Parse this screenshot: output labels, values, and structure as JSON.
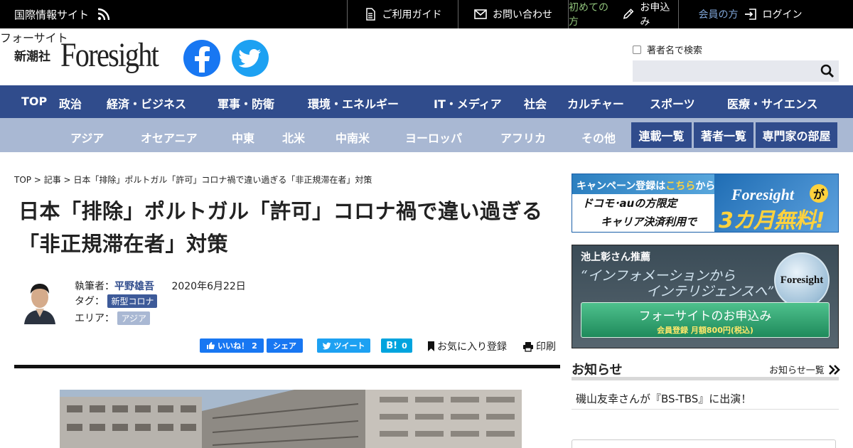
{
  "topbar": {
    "site_name": "国際情報サイト",
    "items": [
      {
        "icon": "document-icon",
        "label": "ご利用ガイド"
      },
      {
        "icon": "mail-icon",
        "label": "お問い合わせ"
      },
      {
        "prefix": "初めての方",
        "icon": "pen-icon",
        "label": "お申込み"
      },
      {
        "prefix": "会員の方",
        "icon": "login-icon",
        "label": "ログイン"
      }
    ]
  },
  "header": {
    "publisher": "新潮社",
    "logo": "Foresight",
    "logo_sub": "フォーサイト",
    "search_checkbox_label": "著者名で検索"
  },
  "main_nav": [
    "TOP",
    "政治",
    "経済・ビジネス",
    "軍事・防衛",
    "環境・エネルギー",
    "IT・メディア",
    "社会",
    "カルチャー",
    "スポーツ",
    "医療・サイエンス"
  ],
  "sub_nav": {
    "regions": [
      "アジア",
      "オセアニア",
      "中東",
      "北米",
      "中南米",
      "ヨーロッパ",
      "アフリカ",
      "その他"
    ],
    "pills": [
      "連載一覧",
      "著者一覧",
      "専門家の部屋"
    ]
  },
  "article": {
    "breadcrumb": "TOP > 記事 > 日本「排除」ポルトガル「許可」コロナ禍で違い過ぎる「非正規滞在者」対策",
    "title": "日本「排除」ポルトガル「許可」コロナ禍で違い過ぎる「非正規滞在者」対策",
    "author_label": "執筆者：",
    "author": "平野雄吾",
    "date": "2020年6月22日",
    "tag_label": "タグ：",
    "tag": "新型コロナ",
    "area_label": "エリア：",
    "area": "アジア"
  },
  "share": {
    "like_label": "いいね！",
    "like_count": "2",
    "share_label": "シェア",
    "tweet_label": "ツイート",
    "hatena_label": "B!",
    "hatena_count": "0",
    "favorite_label": "お気に入り登録",
    "print_label": "印刷"
  },
  "sidebar": {
    "campaign": {
      "head": "キャンペーン登録は",
      "head_hl": "こちら",
      "head_tail": "から",
      "line2": "ドコモ･auの方限定",
      "line3": "キャリア決済利用で",
      "logo": "Foresight",
      "ga": "が",
      "free": "3カ月無料!"
    },
    "promo": {
      "recommend": "池上彰さん推薦",
      "quote1": "“インフォメーションから",
      "quote2": "インテリジェンスへ”",
      "logo": "Foresight",
      "cta": "フォーサイトのお申込み",
      "cta_sub": "会員登録 月額800円(税込)"
    },
    "notice_heading": "お知らせ",
    "notice_more": "お知らせ一覧",
    "notice_item": "磯山友幸さんが『BS-TBS』に出演！"
  },
  "colors": {
    "nav_blue": "#304c8c",
    "subnav_blue": "#a9b8d3",
    "facebook": "#1877f2",
    "twitter": "#1da1f2"
  }
}
